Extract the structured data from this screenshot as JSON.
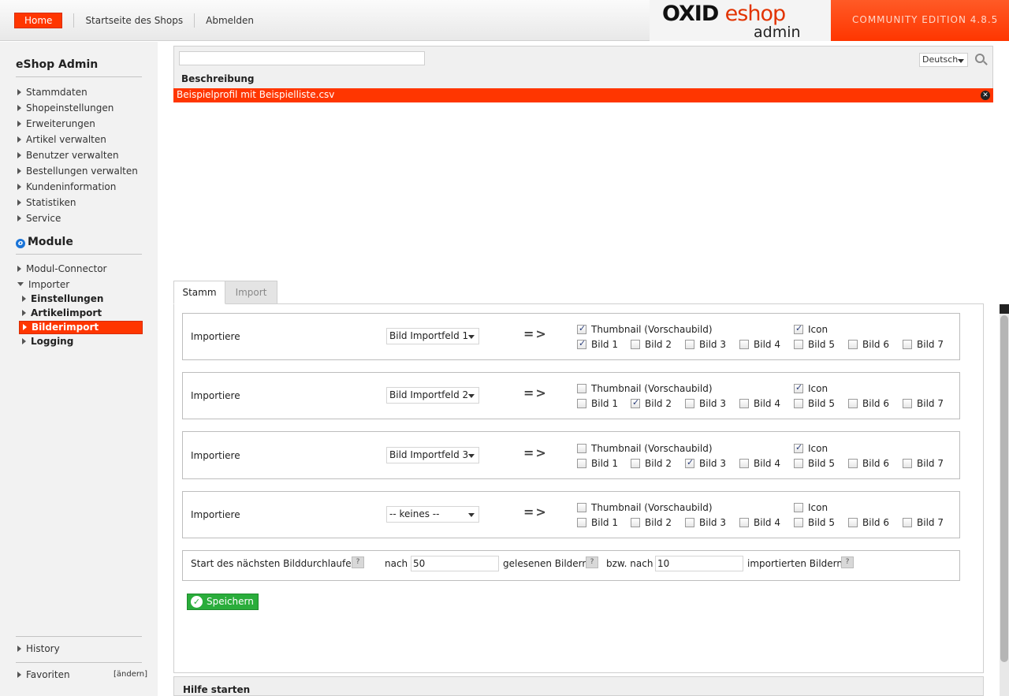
{
  "header": {
    "nav": [
      "Home",
      "Startseite des Shops",
      "Abmelden"
    ],
    "logo_main": "OXID",
    "logo_e": "eshop",
    "logo_sub": "admin",
    "edition": "COMMUNITY EDITION 4.8.5"
  },
  "sidebar": {
    "title": "eShop Admin",
    "items": [
      "Stammdaten",
      "Shopeinstellungen",
      "Erweiterungen",
      "Artikel verwalten",
      "Benutzer verwalten",
      "Bestellungen verwalten",
      "Kundeninformation",
      "Statistiken",
      "Service"
    ],
    "modules_title": "Module",
    "module_items": [
      "Modul-Connector",
      "Importer"
    ],
    "importer_sub": [
      "Einstellungen",
      "Artikelimport",
      "Bilderimport",
      "Logging"
    ],
    "active_sub": "Bilderimport",
    "history": "History",
    "favoriten": "Favoriten",
    "aendern": "[ändern]"
  },
  "list": {
    "search_value": "",
    "language": "Deutsch",
    "column_header": "Beschreibung",
    "selected_row": "Beispielprofil mit Beispielliste.csv"
  },
  "tabs": [
    "Stamm",
    "Import"
  ],
  "rows": [
    {
      "label": "Importiere",
      "select": "Bild Importfeld 1",
      "arrow": "=>",
      "thumbnail": true,
      "icon": true,
      "bilder": [
        true,
        false,
        false,
        false,
        false,
        false,
        false
      ]
    },
    {
      "label": "Importiere",
      "select": "Bild Importfeld 2",
      "arrow": "=>",
      "thumbnail": false,
      "icon": true,
      "bilder": [
        false,
        true,
        false,
        false,
        false,
        false,
        false
      ]
    },
    {
      "label": "Importiere",
      "select": "Bild Importfeld 3",
      "arrow": "=>",
      "thumbnail": false,
      "icon": true,
      "bilder": [
        false,
        false,
        true,
        false,
        false,
        false,
        false
      ]
    },
    {
      "label": "Importiere",
      "select": "-- keines --",
      "arrow": "=>",
      "thumbnail": false,
      "icon": false,
      "bilder": [
        false,
        false,
        false,
        false,
        false,
        false,
        false
      ]
    }
  ],
  "checkbox_labels": {
    "thumbnail": "Thumbnail (Vorschaubild)",
    "icon": "Icon",
    "bilder": [
      "Bild 1",
      "Bild 2",
      "Bild 3",
      "Bild 4",
      "Bild 5",
      "Bild 6",
      "Bild 7"
    ]
  },
  "durchlauf": {
    "start_label": "Start des nächsten Bilddurchlaufes:",
    "nach_label": "nach",
    "gelesen_value": "50",
    "gelesen_label": "gelesenen Bildern",
    "bzw_label": "bzw. nach",
    "importiert_value": "10",
    "importiert_label": "importierten Bildern",
    "help": "?"
  },
  "save_label": "Speichern",
  "help_bar": "Hilfe starten"
}
